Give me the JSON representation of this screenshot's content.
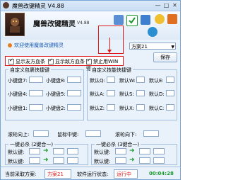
{
  "window": {
    "title": "魔兽改键精灵 V4.88",
    "controls": {
      "minimize": "—",
      "maximize": "□",
      "close": "✕"
    }
  },
  "header": {
    "title": "魔兽改键精灵",
    "version": "V4.88",
    "toolbar_icons": [
      "grid-icon",
      "check-icon",
      "star-icon",
      "help-icon",
      "tools-icon",
      "globe-icon"
    ]
  },
  "promo": {
    "text": "欢迎使用魔兽改键精灵"
  },
  "options": [
    {
      "label": "显示友方血条",
      "checked": true
    },
    {
      "label": "显示敌方血条",
      "checked": true
    },
    {
      "label": "禁止用WIN键",
      "checked": true
    }
  ],
  "scheme": {
    "selected": "方案21",
    "save_label": "保存"
  },
  "inventory_group": {
    "title": "自定义包裹快捷键",
    "slots": [
      "小键盘7:",
      "小键盘8:",
      "小键盘4:",
      "小键盘5:",
      "小键盘1:",
      "小键盘2:"
    ]
  },
  "skill_group": {
    "title": "自定义技能快捷键",
    "slots": [
      "默认Q:",
      "默认W:",
      "默认E:",
      "默认R:",
      "默认A:",
      "默认S:",
      "默认D:",
      "默认F:",
      "默认Z:",
      "默认X:",
      "默认C:",
      "默认V:"
    ]
  },
  "scroll_row": {
    "scroll_up": "滚轮向上:",
    "mouse_mid": "鼠标中键:",
    "scroll_down": "滚轮向下:"
  },
  "combo_left": {
    "title": "一键必杀 (2键合一)",
    "rows": [
      "默认键:",
      "默认键:",
      "默认键:"
    ]
  },
  "combo_right": {
    "title": "一键必杀 (3键合一)",
    "rows": [
      "默认键:",
      "默认键:",
      "默认键:"
    ]
  },
  "status": {
    "current_label": "当前采取方案:",
    "current_value": "方案21",
    "state_label": "软件运行状态:",
    "state_value": "运行中",
    "timer": "00:04:28"
  },
  "colors": {
    "accent_red": "#e01a1a",
    "status_green": "#1a9a2b",
    "link_blue": "#1c5bb5"
  }
}
